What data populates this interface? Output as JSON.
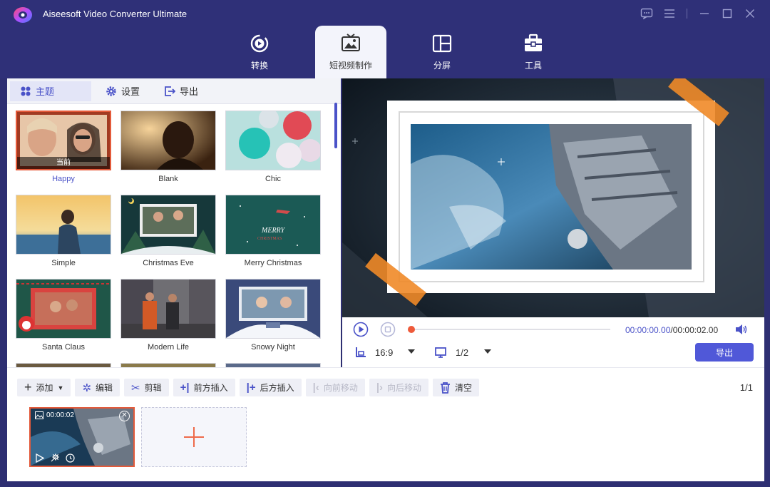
{
  "app": {
    "title": "Aiseesoft Video Converter Ultimate",
    "accent": "#5058d8",
    "highlight": "#e45a3a"
  },
  "main_tabs": [
    {
      "label": "转换",
      "icon": "convert-icon"
    },
    {
      "label": "短视频制作",
      "icon": "mv-icon",
      "active": true
    },
    {
      "label": "分屏",
      "icon": "collage-icon"
    },
    {
      "label": "工具",
      "icon": "toolbox-icon"
    }
  ],
  "sub_tabs": [
    {
      "label": "主题",
      "icon": "theme-icon",
      "active": true
    },
    {
      "label": "设置",
      "icon": "settings-gear-icon"
    },
    {
      "label": "导出",
      "icon": "export-icon"
    }
  ],
  "themes": [
    {
      "label": "Happy",
      "selected": true,
      "badge": "当前"
    },
    {
      "label": "Blank"
    },
    {
      "label": "Chic"
    },
    {
      "label": "Simple"
    },
    {
      "label": "Christmas Eve"
    },
    {
      "label": "Merry Christmas"
    },
    {
      "label": "Santa Claus"
    },
    {
      "label": "Modern Life"
    },
    {
      "label": "Snowy Night"
    }
  ],
  "preview": {
    "time_current": "00:00:00.00",
    "time_total": "/00:00:02.00",
    "aspect": "16:9",
    "zoom": "1/2",
    "export_label": "导出"
  },
  "timeline": {
    "buttons": [
      {
        "label": "添加",
        "icon": "plus-icon"
      },
      {
        "label": "编辑",
        "icon": "magic-wand-icon"
      },
      {
        "label": "剪辑",
        "icon": "scissors-icon"
      },
      {
        "label": "前方插入",
        "icon": "insert-before-icon"
      },
      {
        "label": "后方插入",
        "icon": "insert-after-icon"
      },
      {
        "label": "向前移动",
        "icon": "move-forward-icon",
        "disabled": true
      },
      {
        "label": "向后移动",
        "icon": "move-backward-icon",
        "disabled": true
      },
      {
        "label": "清空",
        "icon": "trash-icon"
      }
    ],
    "page": "1/1",
    "clip_duration": "00:00:02"
  }
}
